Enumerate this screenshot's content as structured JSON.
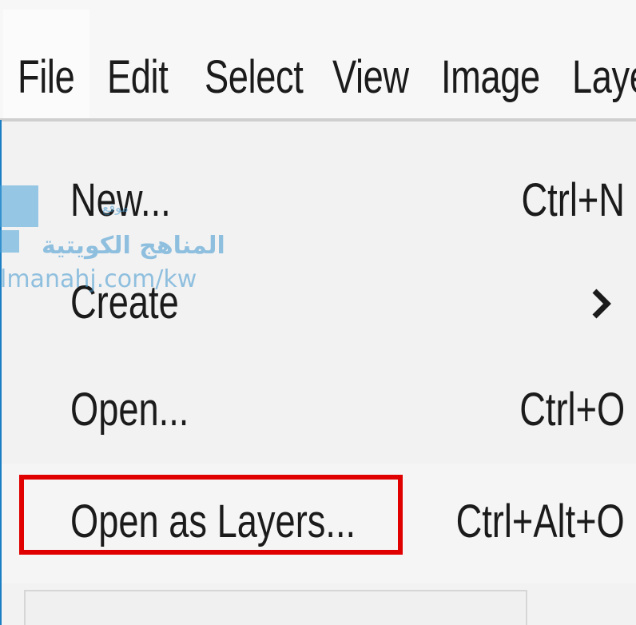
{
  "menubar": {
    "items": [
      {
        "label": "File"
      },
      {
        "label": "Edit"
      },
      {
        "label": "Select"
      },
      {
        "label": "View"
      },
      {
        "label": "Image"
      },
      {
        "label": "Laye"
      }
    ]
  },
  "file_menu": {
    "items": [
      {
        "label": "New...",
        "shortcut": "Ctrl+N"
      },
      {
        "label": "Create",
        "shortcut": "",
        "submenu_icon": "chevron-right-icon"
      },
      {
        "label": "Open...",
        "shortcut": "Ctrl+O"
      },
      {
        "label": "Open as Layers...",
        "shortcut": "Ctrl+Alt+O",
        "highlighted": true
      }
    ]
  },
  "watermark": {
    "small_text": "موقع",
    "arabic_text": "المناهج الكويتية",
    "url": "lmanahj.com/kw"
  },
  "colors": {
    "highlight_border": "#e00000",
    "accent": "#1a7fc4",
    "watermark": "#3f97cf"
  }
}
